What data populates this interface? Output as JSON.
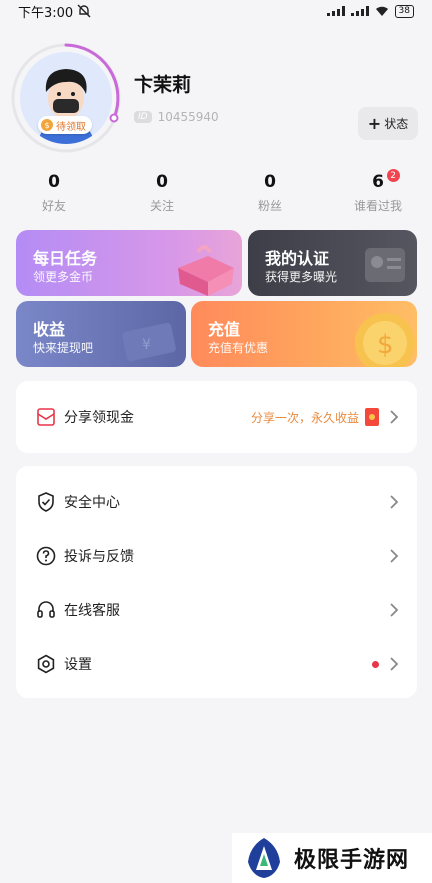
{
  "status_bar": {
    "time": "下午3:00",
    "battery": "38"
  },
  "profile": {
    "name": "卞茉莉",
    "id_tag": "ID",
    "user_id": "10455940",
    "pending_badge": "待领取",
    "status_button": "状态"
  },
  "stats": [
    {
      "value": "0",
      "label": "好友"
    },
    {
      "value": "0",
      "label": "关注"
    },
    {
      "value": "0",
      "label": "粉丝"
    },
    {
      "value": "6",
      "label": "谁看过我",
      "badge": "2"
    }
  ],
  "cards": {
    "daily": {
      "title": "每日任务",
      "subtitle": "领更多金币"
    },
    "cert": {
      "title": "我的认证",
      "subtitle": "获得更多曝光"
    },
    "income": {
      "title": "收益",
      "subtitle": "快来提现吧"
    },
    "recharge": {
      "title": "充值",
      "subtitle": "充值有优惠"
    }
  },
  "share": {
    "label": "分享领现金",
    "note": "分享一次，永久收益"
  },
  "menu": [
    {
      "label": "安全中心",
      "icon": "shield-check-icon"
    },
    {
      "label": "投诉与反馈",
      "icon": "question-circle-icon"
    },
    {
      "label": "在线客服",
      "icon": "headset-icon"
    },
    {
      "label": "设置",
      "icon": "gear-icon"
    }
  ],
  "watermark": {
    "text": "极限手游网"
  },
  "colors": {
    "accent_orange": "#e88a3e",
    "red_dot": "#e8354a",
    "avatar_ring": "#c86ad8"
  }
}
